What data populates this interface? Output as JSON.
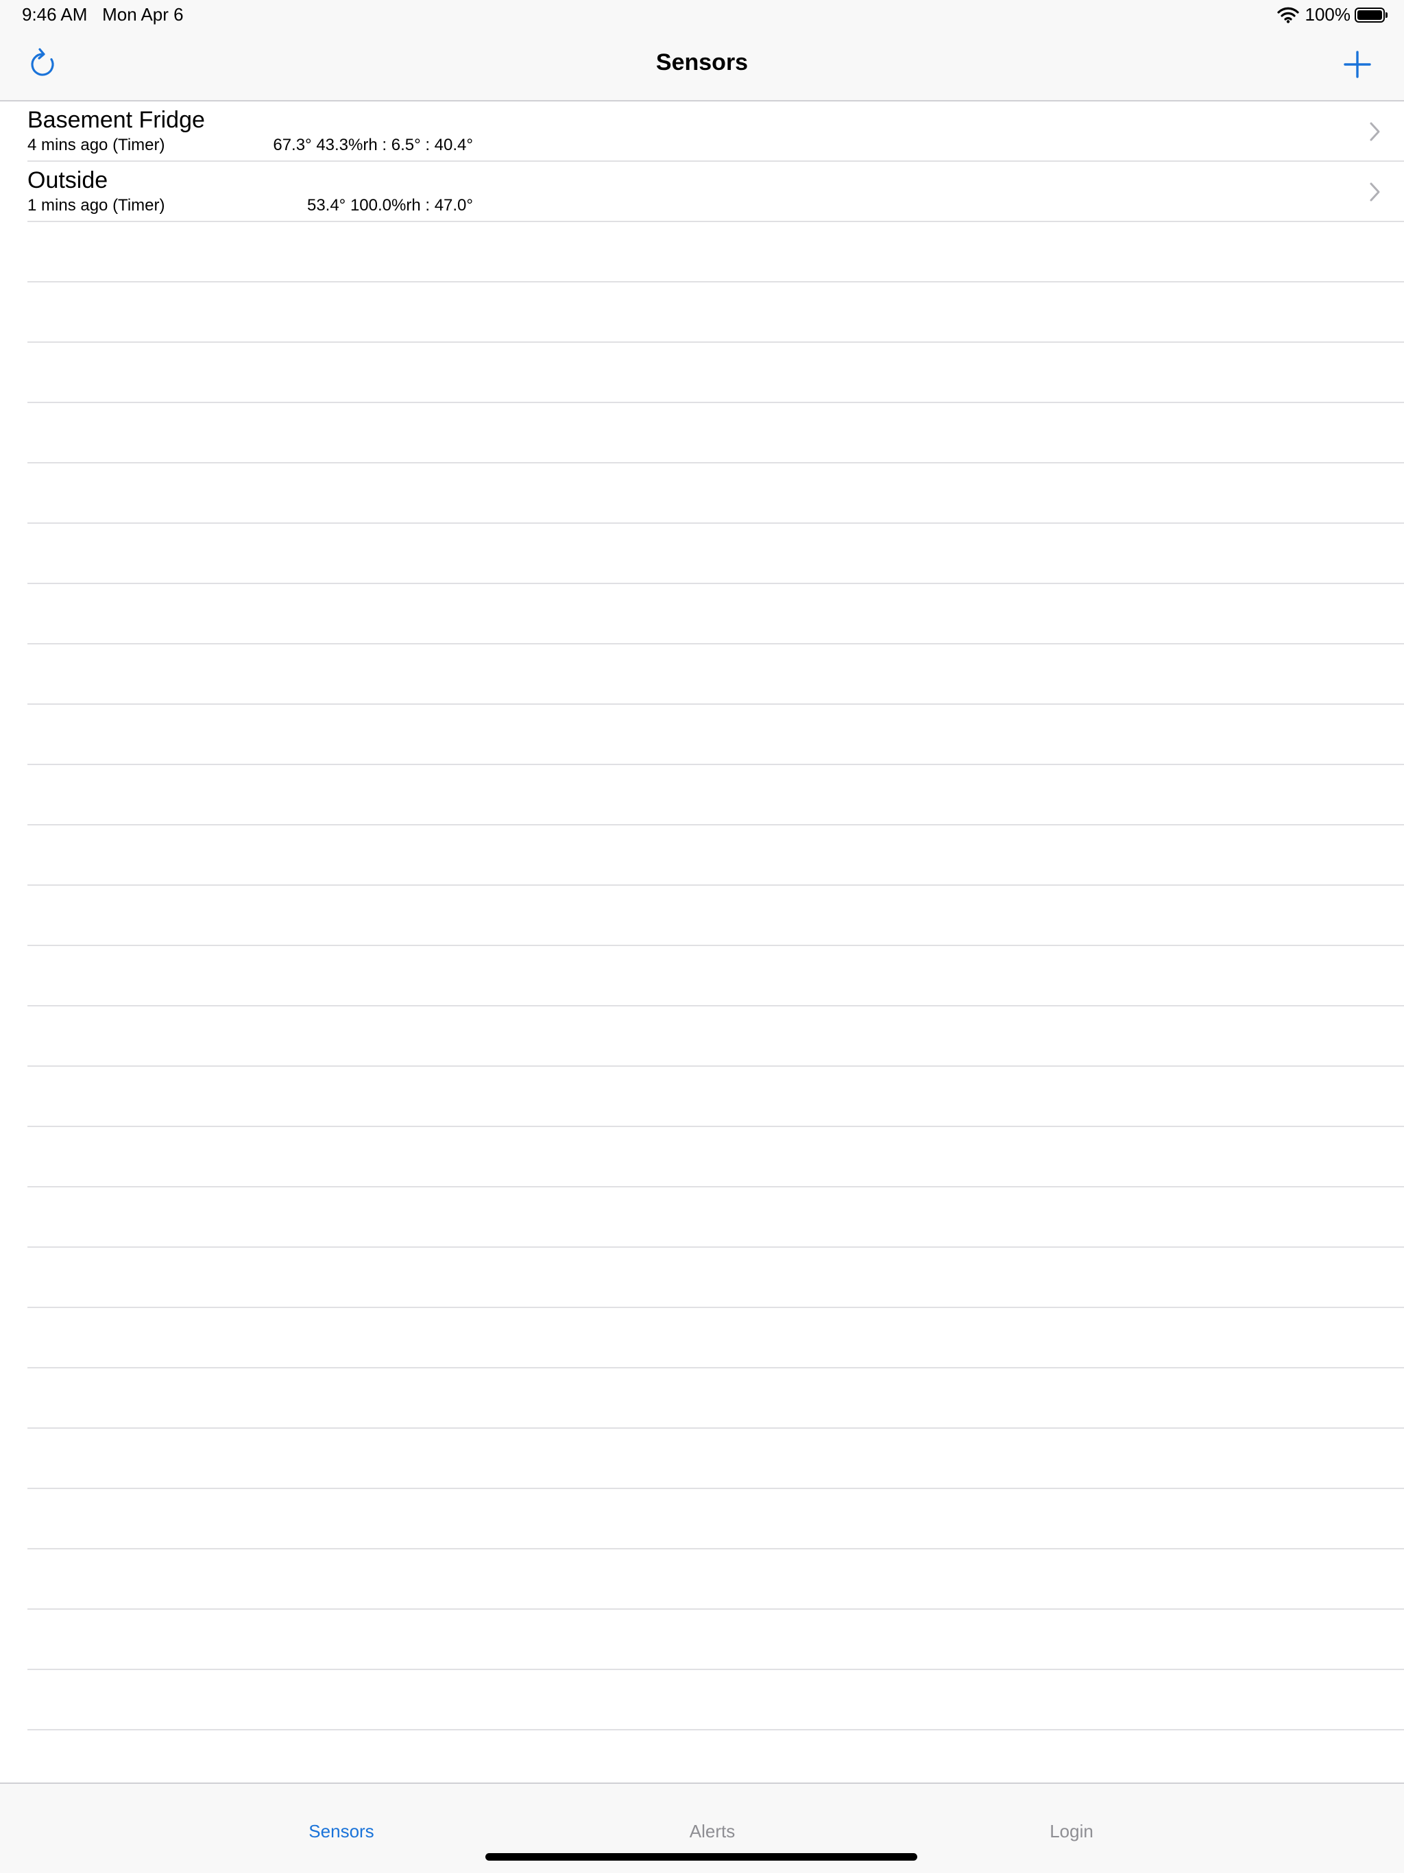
{
  "status_bar": {
    "time": "9:46 AM",
    "date": "Mon Apr 6",
    "battery": "100%"
  },
  "nav": {
    "title": "Sensors",
    "refresh_icon": "refresh-icon",
    "add_icon": "plus-icon",
    "accent": "#1a73d9"
  },
  "sensors": [
    {
      "name": "Basement Fridge",
      "updated": "4 mins ago (Timer)",
      "readings": "67.3° 43.3%rh : 6.5° : 40.4°"
    },
    {
      "name": "Outside",
      "updated": "1 mins ago (Timer)",
      "readings": "53.4° 100.0%rh : 47.0°"
    }
  ],
  "tabs": [
    {
      "label": "Sensors",
      "active": true
    },
    {
      "label": "Alerts",
      "active": false
    },
    {
      "label": "Login",
      "active": false
    }
  ]
}
